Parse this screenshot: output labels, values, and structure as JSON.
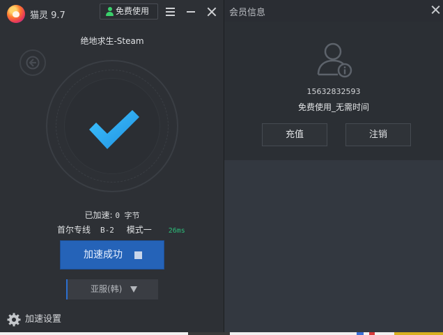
{
  "app": {
    "title": "猫灵 9.7",
    "free_button_label": "免费使用"
  },
  "session": {
    "game_title": "绝地求生-Steam",
    "traffic_label": "已加速:",
    "traffic_value": "0 字节",
    "server_name": "首尔专线",
    "server_code": "B-2",
    "mode": "模式一",
    "ping": "26ms",
    "accelerate_button_label": "加速成功",
    "region_label": "亚服(韩)",
    "settings_label": "加速设置"
  },
  "member_panel": {
    "title": "会员信息",
    "phone": "15632832593",
    "plan_text": "免费使用_无需时间",
    "recharge_label": "充值",
    "logout_label": "注销"
  },
  "colors": {
    "accent_blue": "#2563b8",
    "check_cyan": "#35a8f0",
    "ping_green": "#2dbd7a",
    "panel_dark": "#2d3035"
  },
  "icons": [
    "app-logo",
    "user-icon",
    "menu-icon",
    "minimize-icon",
    "close-icon",
    "back-arrow-icon",
    "checkmark-icon",
    "stop-icon",
    "dropdown-arrow-icon",
    "gear-icon",
    "avatar-info-icon"
  ]
}
